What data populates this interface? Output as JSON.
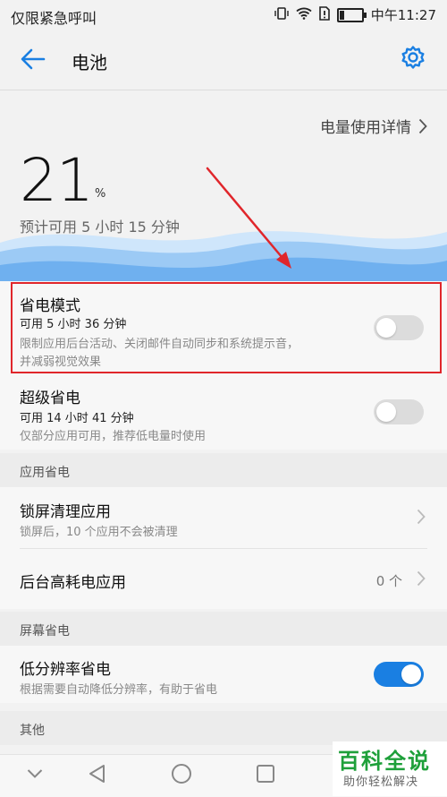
{
  "status_bar": {
    "carrier": "仅限紧急呼叫",
    "time": "中午11:27",
    "battery_level": 0.21
  },
  "header": {
    "title": "电池"
  },
  "battery": {
    "usage_details": "电量使用详情",
    "percent": "21",
    "percent_sign": "%",
    "estimate": "预计可用 5 小时 15 分钟"
  },
  "power_saving": {
    "title": "省电模式",
    "duration": "可用 5 小时 36 分钟",
    "description_line1": "限制应用后台活动、关闭邮件自动同步和系统提示音，",
    "description_line2": "并减弱视觉效果",
    "enabled": false
  },
  "ultra_saving": {
    "title": "超级省电",
    "duration": "可用 14 小时 41 分钟",
    "description": "仅部分应用可用，推荐低电量时使用",
    "enabled": false
  },
  "app_saving": {
    "header": "应用省电",
    "lock_screen_cleanup": {
      "title": "锁屏清理应用",
      "subtitle": "锁屏后，10 个应用不会被清理"
    },
    "background_apps": {
      "title": "后台高耗电应用",
      "count": "0 个"
    }
  },
  "screen_saving": {
    "header": "屏幕省电",
    "low_resolution": {
      "title": "低分辨率省电",
      "subtitle": "根据需要自动降低分辨率，有助于省电",
      "enabled": true
    }
  },
  "other": {
    "header": "其他"
  },
  "watermark": {
    "title": "百科全说",
    "subtitle": "助你轻松解决"
  },
  "colors": {
    "accent": "#1a7fe2",
    "highlight": "#e0262b",
    "watermark": "#1ea03a"
  }
}
